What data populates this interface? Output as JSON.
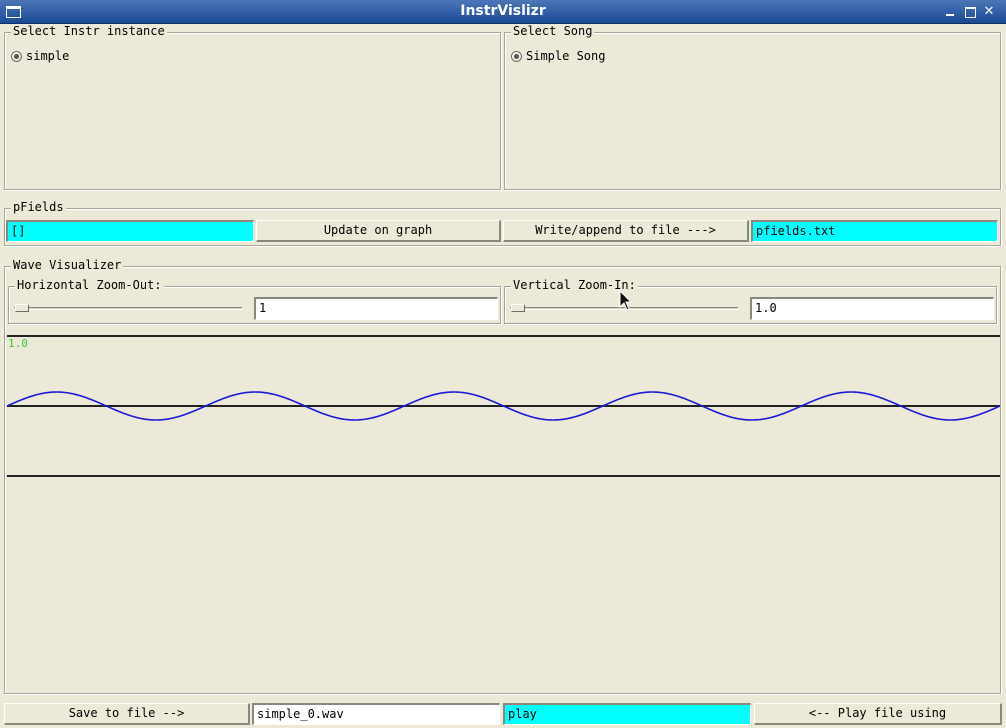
{
  "window": {
    "title": "InstrVislizr"
  },
  "instr_group": {
    "legend": "Select Instr instance",
    "options": [
      {
        "label": "simple",
        "selected": true
      }
    ]
  },
  "song_group": {
    "legend": "Select Song",
    "options": [
      {
        "label": "Simple Song",
        "selected": true
      }
    ]
  },
  "pfields": {
    "legend": "pFields",
    "input_value": "[]",
    "update_button": "Update on graph",
    "write_button": "Write/append to file --->",
    "file_value": "pfields.txt"
  },
  "wave": {
    "legend": "Wave Visualizer",
    "horizontal": {
      "legend": "Horizontal Zoom-Out:",
      "value": "1",
      "slider_fraction": 0.0
    },
    "vertical": {
      "legend": "Vertical Zoom-In:",
      "value": "1.0",
      "slider_fraction": 0.0
    },
    "scale_label": "1.0",
    "wave_color": "#1a1ad6",
    "label_color": "#33cc33",
    "cycles_visible": 5
  },
  "footer": {
    "save_button": "Save to file -->",
    "wav_value": "simple_0.wav",
    "player_value": "play",
    "play_button": "<-- Play file using"
  },
  "colors": {
    "highlight_input": "#00ffff",
    "background": "#ece9d8"
  }
}
